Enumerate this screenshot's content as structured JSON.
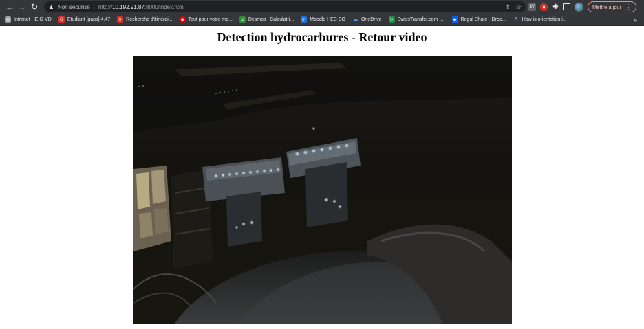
{
  "browser": {
    "security_label": "Non sécurisé",
    "url_scheme": "http://",
    "url_host": "10.192.91.87",
    "url_rest": ":8000/index.html",
    "update_label": "Mettre à jour"
  },
  "bookmarks": [
    {
      "label": "Intranet HEIG-VD",
      "icon": "globe-icon",
      "color": "#9aa0a6",
      "glyph": "◍"
    },
    {
      "label": "Etudiant [gaps] 4.47",
      "icon": "gaps-icon",
      "color": "#d93025",
      "glyph": "G"
    },
    {
      "label": "Recherche d'itinérai...",
      "icon": "sbb-icon",
      "color": "#d93025",
      "glyph": "✕"
    },
    {
      "label": "Tout pour votre mo...",
      "icon": "sbb-round-icon",
      "color": "#eb0000",
      "glyph": "◉"
    },
    {
      "label": "Desmos | Calculatri...",
      "icon": "desmos-icon",
      "color": "#2e8b3a",
      "glyph": "ω"
    },
    {
      "label": "Moodle HES-SO",
      "icon": "moodle-icon",
      "color": "#1a73e8",
      "glyph": "m"
    },
    {
      "label": "OneDrive",
      "icon": "onedrive-icon",
      "color": "#0a84ff",
      "glyph": "☁"
    },
    {
      "label": "SwissTransfer.com -...",
      "icon": "swisstransfer-icon",
      "color": "#1e8e3e",
      "glyph": "↻"
    },
    {
      "label": "Regul Share - Drop...",
      "icon": "dropbox-icon",
      "color": "#0061fe",
      "glyph": "◆"
    },
    {
      "label": "How is orientation i...",
      "icon": "unity-icon",
      "color": "#5f6368",
      "glyph": "Λ"
    }
  ],
  "page": {
    "title": "Detection hydrocarbures - Retour video"
  }
}
